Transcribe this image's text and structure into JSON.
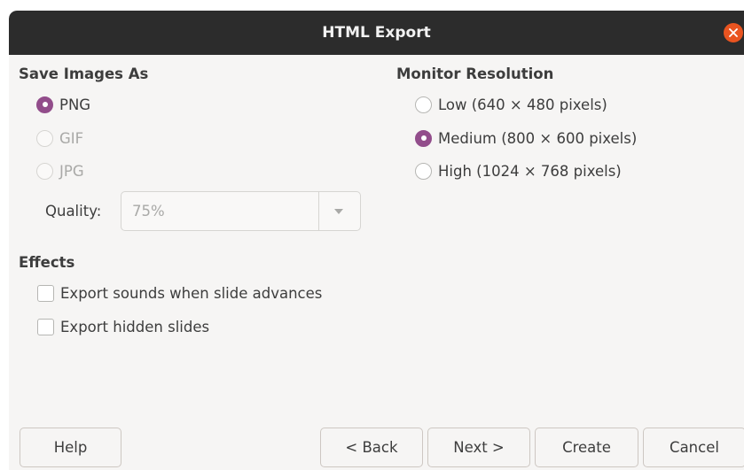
{
  "window": {
    "title": "HTML Export"
  },
  "save_images": {
    "heading": "Save Images As",
    "options": [
      {
        "label": "PNG",
        "selected": true,
        "enabled": true
      },
      {
        "label": "GIF",
        "selected": false,
        "enabled": false
      },
      {
        "label": "JPG",
        "selected": false,
        "enabled": false
      }
    ],
    "quality": {
      "label": "Quality:",
      "value": "75%"
    }
  },
  "monitor_resolution": {
    "heading": "Monitor Resolution",
    "options": [
      {
        "label": "Low (640 × 480 pixels)",
        "selected": false
      },
      {
        "label": "Medium (800 × 600 pixels)",
        "selected": true
      },
      {
        "label": "High (1024 × 768 pixels)",
        "selected": false
      }
    ]
  },
  "effects": {
    "heading": "Effects",
    "options": [
      {
        "label": "Export sounds when slide advances",
        "checked": false
      },
      {
        "label": "Export hidden slides",
        "checked": false
      }
    ]
  },
  "buttons": {
    "help": "Help",
    "back": "< Back",
    "next": "Next >",
    "create": "Create",
    "cancel": "Cancel"
  },
  "colors": {
    "titlebar": "#2c2c2c",
    "accent_radio": "#924d8b",
    "close_button": "#e95420",
    "dialog_bg": "#f6f5f4"
  },
  "icons": {
    "close": "close-icon",
    "dropdown": "chevron-down-icon"
  }
}
